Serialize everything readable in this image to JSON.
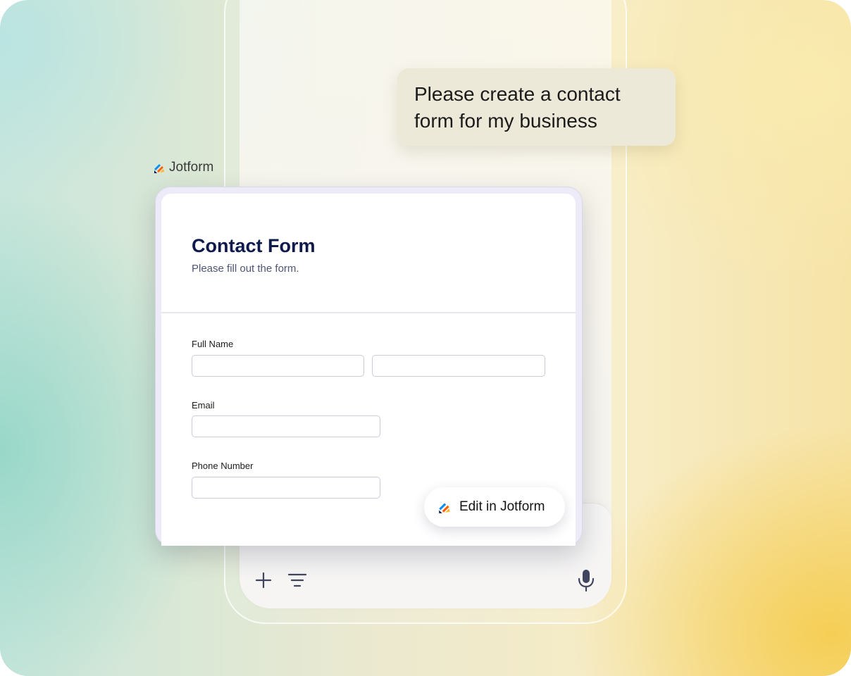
{
  "chat": {
    "message": "Please create a contact form for my business"
  },
  "brand": {
    "name": "Jotform",
    "logo_icon": "jotform-logo-icon",
    "colors": {
      "blue": "#0a8ef5",
      "orange": "#ff6100",
      "yellow": "#ffb629",
      "navy": "#0a1551"
    }
  },
  "form": {
    "title": "Contact Form",
    "subtitle": "Please fill out the form.",
    "fields": [
      {
        "label": "Full Name",
        "first_value": "",
        "last_value": ""
      },
      {
        "label": "Email",
        "value": ""
      },
      {
        "label": "Phone Number",
        "value": ""
      }
    ]
  },
  "actions": {
    "edit_label": "Edit in Jotform"
  },
  "prompt_bar": {
    "icons": [
      "plus-icon",
      "filter-icon",
      "microphone-icon"
    ]
  }
}
